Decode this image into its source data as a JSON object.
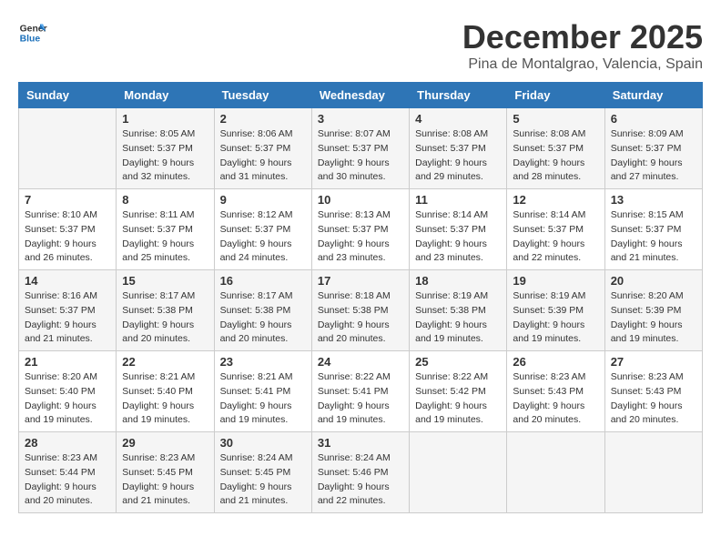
{
  "logo": {
    "line1": "General",
    "line2": "Blue"
  },
  "title": "December 2025",
  "location": "Pina de Montalgrao, Valencia, Spain",
  "days_of_week": [
    "Sunday",
    "Monday",
    "Tuesday",
    "Wednesday",
    "Thursday",
    "Friday",
    "Saturday"
  ],
  "weeks": [
    [
      {
        "day": "",
        "info": ""
      },
      {
        "day": "1",
        "info": "Sunrise: 8:05 AM\nSunset: 5:37 PM\nDaylight: 9 hours\nand 32 minutes."
      },
      {
        "day": "2",
        "info": "Sunrise: 8:06 AM\nSunset: 5:37 PM\nDaylight: 9 hours\nand 31 minutes."
      },
      {
        "day": "3",
        "info": "Sunrise: 8:07 AM\nSunset: 5:37 PM\nDaylight: 9 hours\nand 30 minutes."
      },
      {
        "day": "4",
        "info": "Sunrise: 8:08 AM\nSunset: 5:37 PM\nDaylight: 9 hours\nand 29 minutes."
      },
      {
        "day": "5",
        "info": "Sunrise: 8:08 AM\nSunset: 5:37 PM\nDaylight: 9 hours\nand 28 minutes."
      },
      {
        "day": "6",
        "info": "Sunrise: 8:09 AM\nSunset: 5:37 PM\nDaylight: 9 hours\nand 27 minutes."
      }
    ],
    [
      {
        "day": "7",
        "info": "Sunrise: 8:10 AM\nSunset: 5:37 PM\nDaylight: 9 hours\nand 26 minutes."
      },
      {
        "day": "8",
        "info": "Sunrise: 8:11 AM\nSunset: 5:37 PM\nDaylight: 9 hours\nand 25 minutes."
      },
      {
        "day": "9",
        "info": "Sunrise: 8:12 AM\nSunset: 5:37 PM\nDaylight: 9 hours\nand 24 minutes."
      },
      {
        "day": "10",
        "info": "Sunrise: 8:13 AM\nSunset: 5:37 PM\nDaylight: 9 hours\nand 23 minutes."
      },
      {
        "day": "11",
        "info": "Sunrise: 8:14 AM\nSunset: 5:37 PM\nDaylight: 9 hours\nand 23 minutes."
      },
      {
        "day": "12",
        "info": "Sunrise: 8:14 AM\nSunset: 5:37 PM\nDaylight: 9 hours\nand 22 minutes."
      },
      {
        "day": "13",
        "info": "Sunrise: 8:15 AM\nSunset: 5:37 PM\nDaylight: 9 hours\nand 21 minutes."
      }
    ],
    [
      {
        "day": "14",
        "info": "Sunrise: 8:16 AM\nSunset: 5:37 PM\nDaylight: 9 hours\nand 21 minutes."
      },
      {
        "day": "15",
        "info": "Sunrise: 8:17 AM\nSunset: 5:38 PM\nDaylight: 9 hours\nand 20 minutes."
      },
      {
        "day": "16",
        "info": "Sunrise: 8:17 AM\nSunset: 5:38 PM\nDaylight: 9 hours\nand 20 minutes."
      },
      {
        "day": "17",
        "info": "Sunrise: 8:18 AM\nSunset: 5:38 PM\nDaylight: 9 hours\nand 20 minutes."
      },
      {
        "day": "18",
        "info": "Sunrise: 8:19 AM\nSunset: 5:38 PM\nDaylight: 9 hours\nand 19 minutes."
      },
      {
        "day": "19",
        "info": "Sunrise: 8:19 AM\nSunset: 5:39 PM\nDaylight: 9 hours\nand 19 minutes."
      },
      {
        "day": "20",
        "info": "Sunrise: 8:20 AM\nSunset: 5:39 PM\nDaylight: 9 hours\nand 19 minutes."
      }
    ],
    [
      {
        "day": "21",
        "info": "Sunrise: 8:20 AM\nSunset: 5:40 PM\nDaylight: 9 hours\nand 19 minutes."
      },
      {
        "day": "22",
        "info": "Sunrise: 8:21 AM\nSunset: 5:40 PM\nDaylight: 9 hours\nand 19 minutes."
      },
      {
        "day": "23",
        "info": "Sunrise: 8:21 AM\nSunset: 5:41 PM\nDaylight: 9 hours\nand 19 minutes."
      },
      {
        "day": "24",
        "info": "Sunrise: 8:22 AM\nSunset: 5:41 PM\nDaylight: 9 hours\nand 19 minutes."
      },
      {
        "day": "25",
        "info": "Sunrise: 8:22 AM\nSunset: 5:42 PM\nDaylight: 9 hours\nand 19 minutes."
      },
      {
        "day": "26",
        "info": "Sunrise: 8:23 AM\nSunset: 5:43 PM\nDaylight: 9 hours\nand 20 minutes."
      },
      {
        "day": "27",
        "info": "Sunrise: 8:23 AM\nSunset: 5:43 PM\nDaylight: 9 hours\nand 20 minutes."
      }
    ],
    [
      {
        "day": "28",
        "info": "Sunrise: 8:23 AM\nSunset: 5:44 PM\nDaylight: 9 hours\nand 20 minutes."
      },
      {
        "day": "29",
        "info": "Sunrise: 8:23 AM\nSunset: 5:45 PM\nDaylight: 9 hours\nand 21 minutes."
      },
      {
        "day": "30",
        "info": "Sunrise: 8:24 AM\nSunset: 5:45 PM\nDaylight: 9 hours\nand 21 minutes."
      },
      {
        "day": "31",
        "info": "Sunrise: 8:24 AM\nSunset: 5:46 PM\nDaylight: 9 hours\nand 22 minutes."
      },
      {
        "day": "",
        "info": ""
      },
      {
        "day": "",
        "info": ""
      },
      {
        "day": "",
        "info": ""
      }
    ]
  ]
}
